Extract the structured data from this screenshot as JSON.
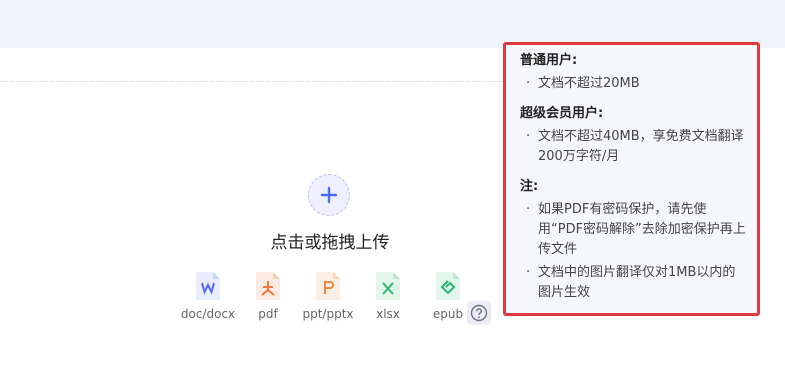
{
  "upload": {
    "label": "点击或拖拽上传",
    "file_types": [
      {
        "label": "doc/docx",
        "icon": "word-file-icon",
        "color": "#4b6cf7"
      },
      {
        "label": "pdf",
        "icon": "pdf-file-icon",
        "color": "#f07a3e"
      },
      {
        "label": "ppt/pptx",
        "icon": "ppt-file-icon",
        "color": "#f0873e"
      },
      {
        "label": "xlsx",
        "icon": "excel-file-icon",
        "color": "#2bb673"
      },
      {
        "label": "epub",
        "icon": "epub-file-icon",
        "color": "#2bb673"
      }
    ]
  },
  "tooltip": {
    "normal_title": "普通用户:",
    "normal_items": [
      "文档不超过20MB"
    ],
    "vip_title": "超级会员用户:",
    "vip_items": [
      "文档不超过40MB，享免费文档翻译200万字符/月"
    ],
    "note_title": "注:",
    "note_items": [
      "如果PDF有密码保护，请先使用“PDF密码解除”去除加密保护再上传文件",
      "文档中的图片翻译仅对1MB以内的图片生效"
    ]
  },
  "bullet": "·",
  "colors": {
    "accent": "#4b6cf7",
    "highlight_border": "#e0393e"
  }
}
